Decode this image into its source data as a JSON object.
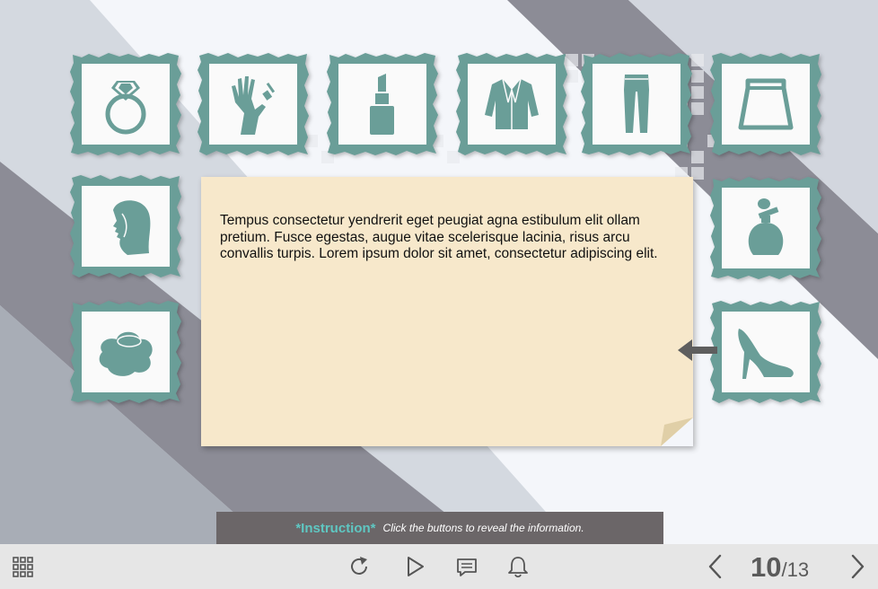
{
  "note": {
    "text": "Tempus consectetur yendrerit eget peugiat agna estibulum elit ollam pretium. Fusce egestas, augue vitae scelerisque lacinia, risus arcu convallis turpis. Lorem ipsum dolor sit amet, consectetur adipiscing elit."
  },
  "instruction": {
    "label": "*Instruction*",
    "text": "Click the buttons to reveal the information."
  },
  "tiles": [
    {
      "icon": "ring-icon"
    },
    {
      "icon": "nail-polish-hand-icon"
    },
    {
      "icon": "lipstick-icon"
    },
    {
      "icon": "jacket-icon"
    },
    {
      "icon": "trousers-icon"
    },
    {
      "icon": "skirt-icon"
    },
    {
      "icon": "woman-hair-icon"
    },
    {
      "icon": "perfume-icon"
    },
    {
      "icon": "hat-icon"
    },
    {
      "icon": "high-heel-shoe-icon"
    }
  ],
  "toolbar": {
    "icons": [
      "menu-grid-icon",
      "replay-icon",
      "play-icon",
      "comment-icon",
      "bell-icon",
      "prev-arrow-icon",
      "next-arrow-icon"
    ]
  },
  "pagination": {
    "current": "10",
    "separator": "/",
    "total": "13"
  },
  "colors": {
    "accent": "#6a9e98",
    "note_bg": "#f7e8cb",
    "instruction_bg": "#6b6668",
    "instruction_label": "#5fc7c2",
    "toolbar_bg": "#e6e6e6"
  }
}
